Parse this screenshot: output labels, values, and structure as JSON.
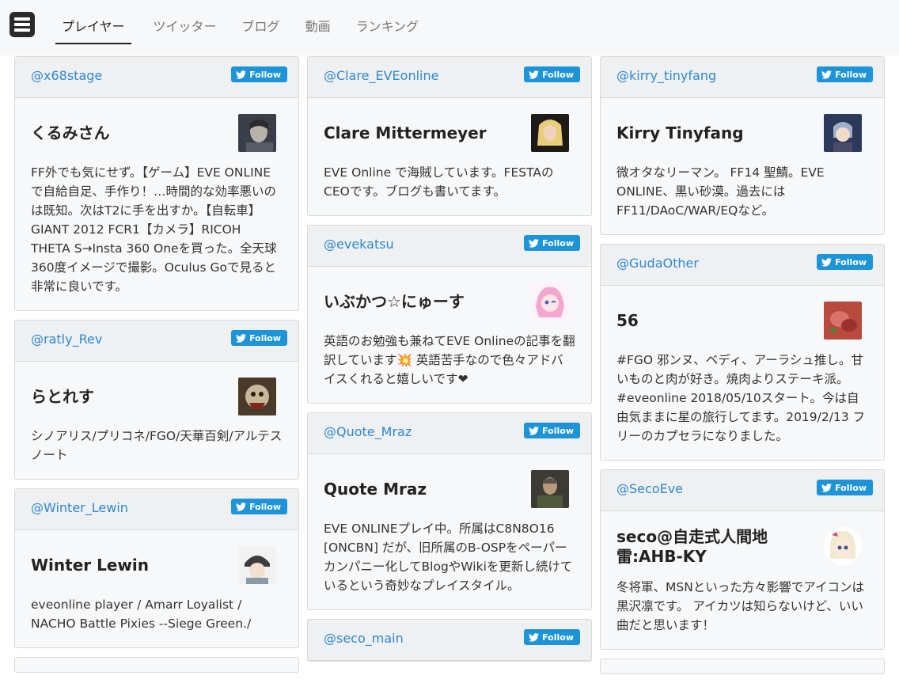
{
  "nav": {
    "tabs": [
      {
        "label": "プレイヤー",
        "active": true
      },
      {
        "label": "ツイッター"
      },
      {
        "label": "ブログ"
      },
      {
        "label": "動画"
      },
      {
        "label": "ランキング"
      }
    ]
  },
  "follow_label": "Follow",
  "columns": [
    [
      {
        "handle": "@x68stage",
        "name": "くるみさん",
        "bio": "FF外でも気にせず。【ゲーム】EVE ONLINEで自給自足、手作り！…時間的な効率悪いのは既知。次はT2に手を出すか。【自転車】GIANT 2012 FCR1【カメラ】RICOH THETA S→Insta 360 Oneを買った。全天球360度イメージで撮影。Oculus Goで見ると非常に良いです。"
      },
      {
        "handle": "@ratly_Rev",
        "name": "らとれす",
        "bio": "シノアリス/プリコネ/FGO/天華百剣/アルテスノート"
      },
      {
        "handle": "@Winter_Lewin",
        "name": "Winter Lewin",
        "bio": "eveonline player / Amarr Loyalist / NACHO Battle Pixies --Siege Green./"
      }
    ],
    [
      {
        "handle": "@Clare_EVEonline",
        "name": "Clare Mittermeyer",
        "bio": "EVE Online で海賊しています。FESTAのCEOです。ブログも書いてます。"
      },
      {
        "handle": "@evekatsu",
        "name": "いぶかつ☆にゅーす",
        "bio": "英語のお勉強も兼ねてEVE Onlineの記事を翻訳しています💥 英語苦手なので色々アドバイスくれると嬉しいです❤"
      },
      {
        "handle": "@Quote_Mraz",
        "name": "Quote Mraz",
        "bio": "EVE ONLINEプレイ中。所属はC8N8O16 [ONCBN] だが、旧所属のB-OSPをペーパーカンパニー化してBlogやWikiを更新し続けているという奇妙なプレイスタイル。"
      },
      {
        "handle": "@seco_main",
        "name": "",
        "bio": ""
      }
    ],
    [
      {
        "handle": "@kirry_tinyfang",
        "name": "Kirry Tinyfang",
        "bio": "微オタなリーマン。 FF14 聖鯖。EVE ONLINE、黒い砂漠。過去にはFF11/DAoC/WAR/EQなど。"
      },
      {
        "handle": "@GudaOther",
        "name": "56",
        "bio": "#FGO 邪ンヌ、ベディ、アーラシュ推し。甘いものと肉が好き。焼肉よりステーキ派。#eveonline 2018/05/10スタート。今は自由気ままに星の旅行してます。2019/2/13 フリーのカプセラになりました。"
      },
      {
        "handle": "@SecoEve",
        "name": "seco@自走式人間地雷:AHB-KY",
        "bio": "冬将軍、MSNといった方々影響でアイコンは黒沢凛です。 アイカツは知らないけど、いい曲だと思います！"
      }
    ]
  ],
  "colors": {
    "link": "#2f88cf",
    "follow_bg": "#1d93d8",
    "card_bg": "#f7f8f9",
    "header_bg": "#eef0f2"
  }
}
